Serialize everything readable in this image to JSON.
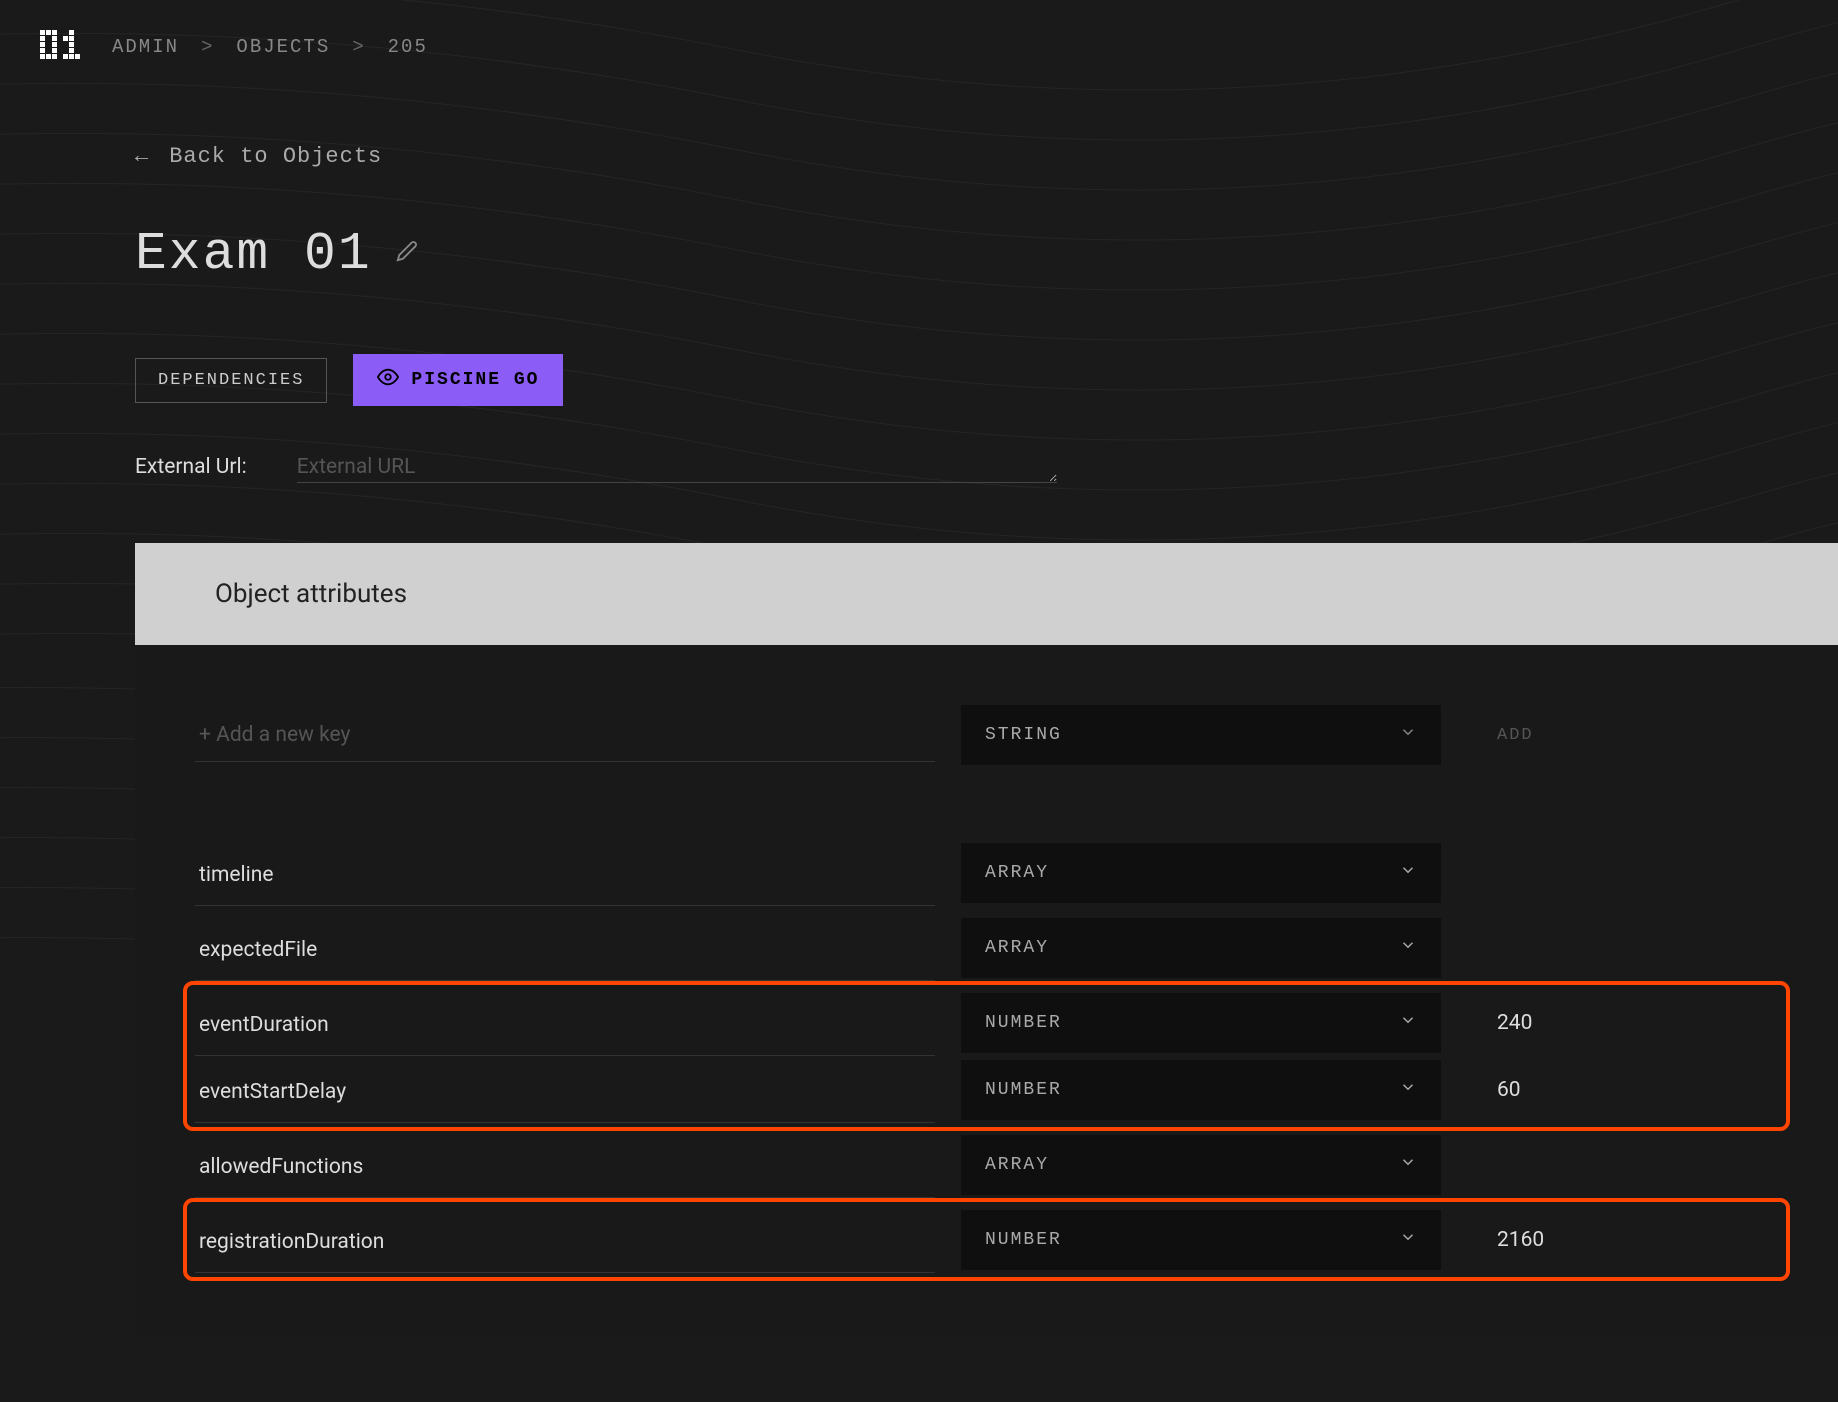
{
  "logo": "01",
  "breadcrumb": {
    "items": [
      "ADMIN",
      "OBJECTS",
      "205"
    ],
    "sep": ">"
  },
  "back": {
    "arrow": "←",
    "label": "Back to Objects"
  },
  "title": "Exam 01",
  "buttons": {
    "dependencies": "DEPENDENCIES",
    "piscine": "PISCINE GO"
  },
  "externalUrl": {
    "label": "External Url:",
    "placeholder": "External URL",
    "value": ""
  },
  "section": {
    "header": "Object attributes"
  },
  "addKey": {
    "placeholder": "+ Add a new key",
    "typeSelected": "STRING",
    "addBtn": "ADD"
  },
  "attributes": [
    {
      "key": "timeline",
      "type": "ARRAY",
      "value": "",
      "highlight": false
    },
    {
      "key": "expectedFile",
      "type": "ARRAY",
      "value": "",
      "highlight": false
    },
    {
      "key": "eventDuration",
      "type": "NUMBER",
      "value": "240",
      "highlight": true,
      "group": 1
    },
    {
      "key": "eventStartDelay",
      "type": "NUMBER",
      "value": "60",
      "highlight": true,
      "group": 1
    },
    {
      "key": "allowedFunctions",
      "type": "ARRAY",
      "value": "",
      "highlight": false
    },
    {
      "key": "registrationDuration",
      "type": "NUMBER",
      "value": "2160",
      "highlight": true,
      "group": 2
    }
  ],
  "colors": {
    "accent": "#8b5cf6",
    "highlight": "#ff4500"
  }
}
